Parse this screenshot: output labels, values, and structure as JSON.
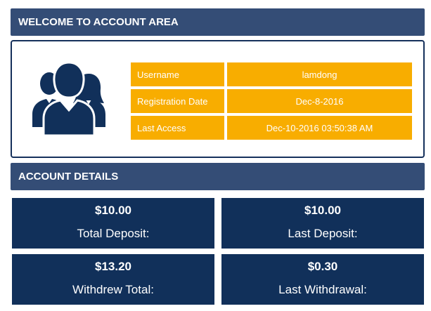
{
  "welcome": {
    "title": "WELCOME TO ACCOUNT AREA",
    "avatar_icon": "users-group-icon",
    "rows": [
      {
        "label": "Username",
        "value": "lamdong"
      },
      {
        "label": "Registration Date",
        "value": "Dec-8-2016"
      },
      {
        "label": "Last Access",
        "value": "Dec-10-2016 03:50:38 AM"
      }
    ]
  },
  "details": {
    "title": "ACCOUNT DETAILS",
    "cards": [
      {
        "amount": "$10.00",
        "caption": "Total Deposit:"
      },
      {
        "amount": "$10.00",
        "caption": "Last Deposit:"
      },
      {
        "amount": "$13.20",
        "caption": "Withdrew Total:"
      },
      {
        "amount": "$0.30",
        "caption": "Last Withdrawal:"
      }
    ]
  },
  "colors": {
    "header_bg": "#344d76",
    "card_bg": "#11305a",
    "info_bg": "#f8ad00",
    "border": "#15305b"
  }
}
